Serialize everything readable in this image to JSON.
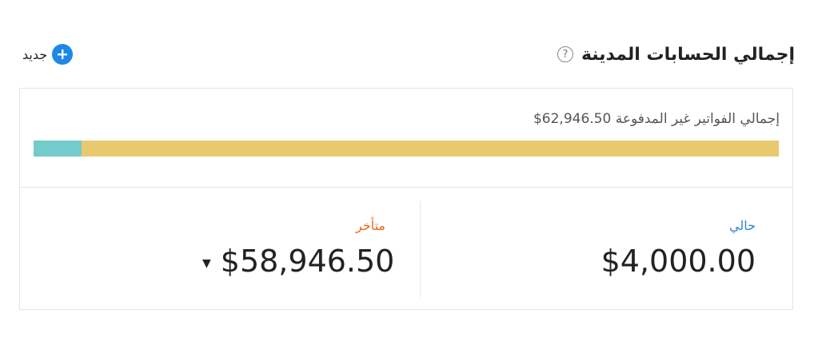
{
  "header": {
    "title": "إجمالي الحسابات المدينة",
    "help_icon": "question-circle-icon",
    "help_glyph": "?",
    "new_label": "جديد",
    "new_icon": "plus-circle-icon"
  },
  "unpaid": {
    "label": "إجمالي الفواتير غير المدفوعة",
    "amount": "$62,946.50",
    "bar": {
      "overdue_fraction": 0.064,
      "current_color": "#e9c96e",
      "overdue_color": "#73cbcb"
    }
  },
  "current": {
    "label": "حالي",
    "value": "$4,000.00",
    "label_color": "#2f86d0"
  },
  "overdue": {
    "label": "متأخر",
    "value": "$58,946.50",
    "label_color": "#ea6a20",
    "caret_icon": "caret-down-icon",
    "caret_glyph": "▼"
  },
  "colors": {
    "accent": "#1e88e5",
    "border": "#e4e4e4"
  }
}
